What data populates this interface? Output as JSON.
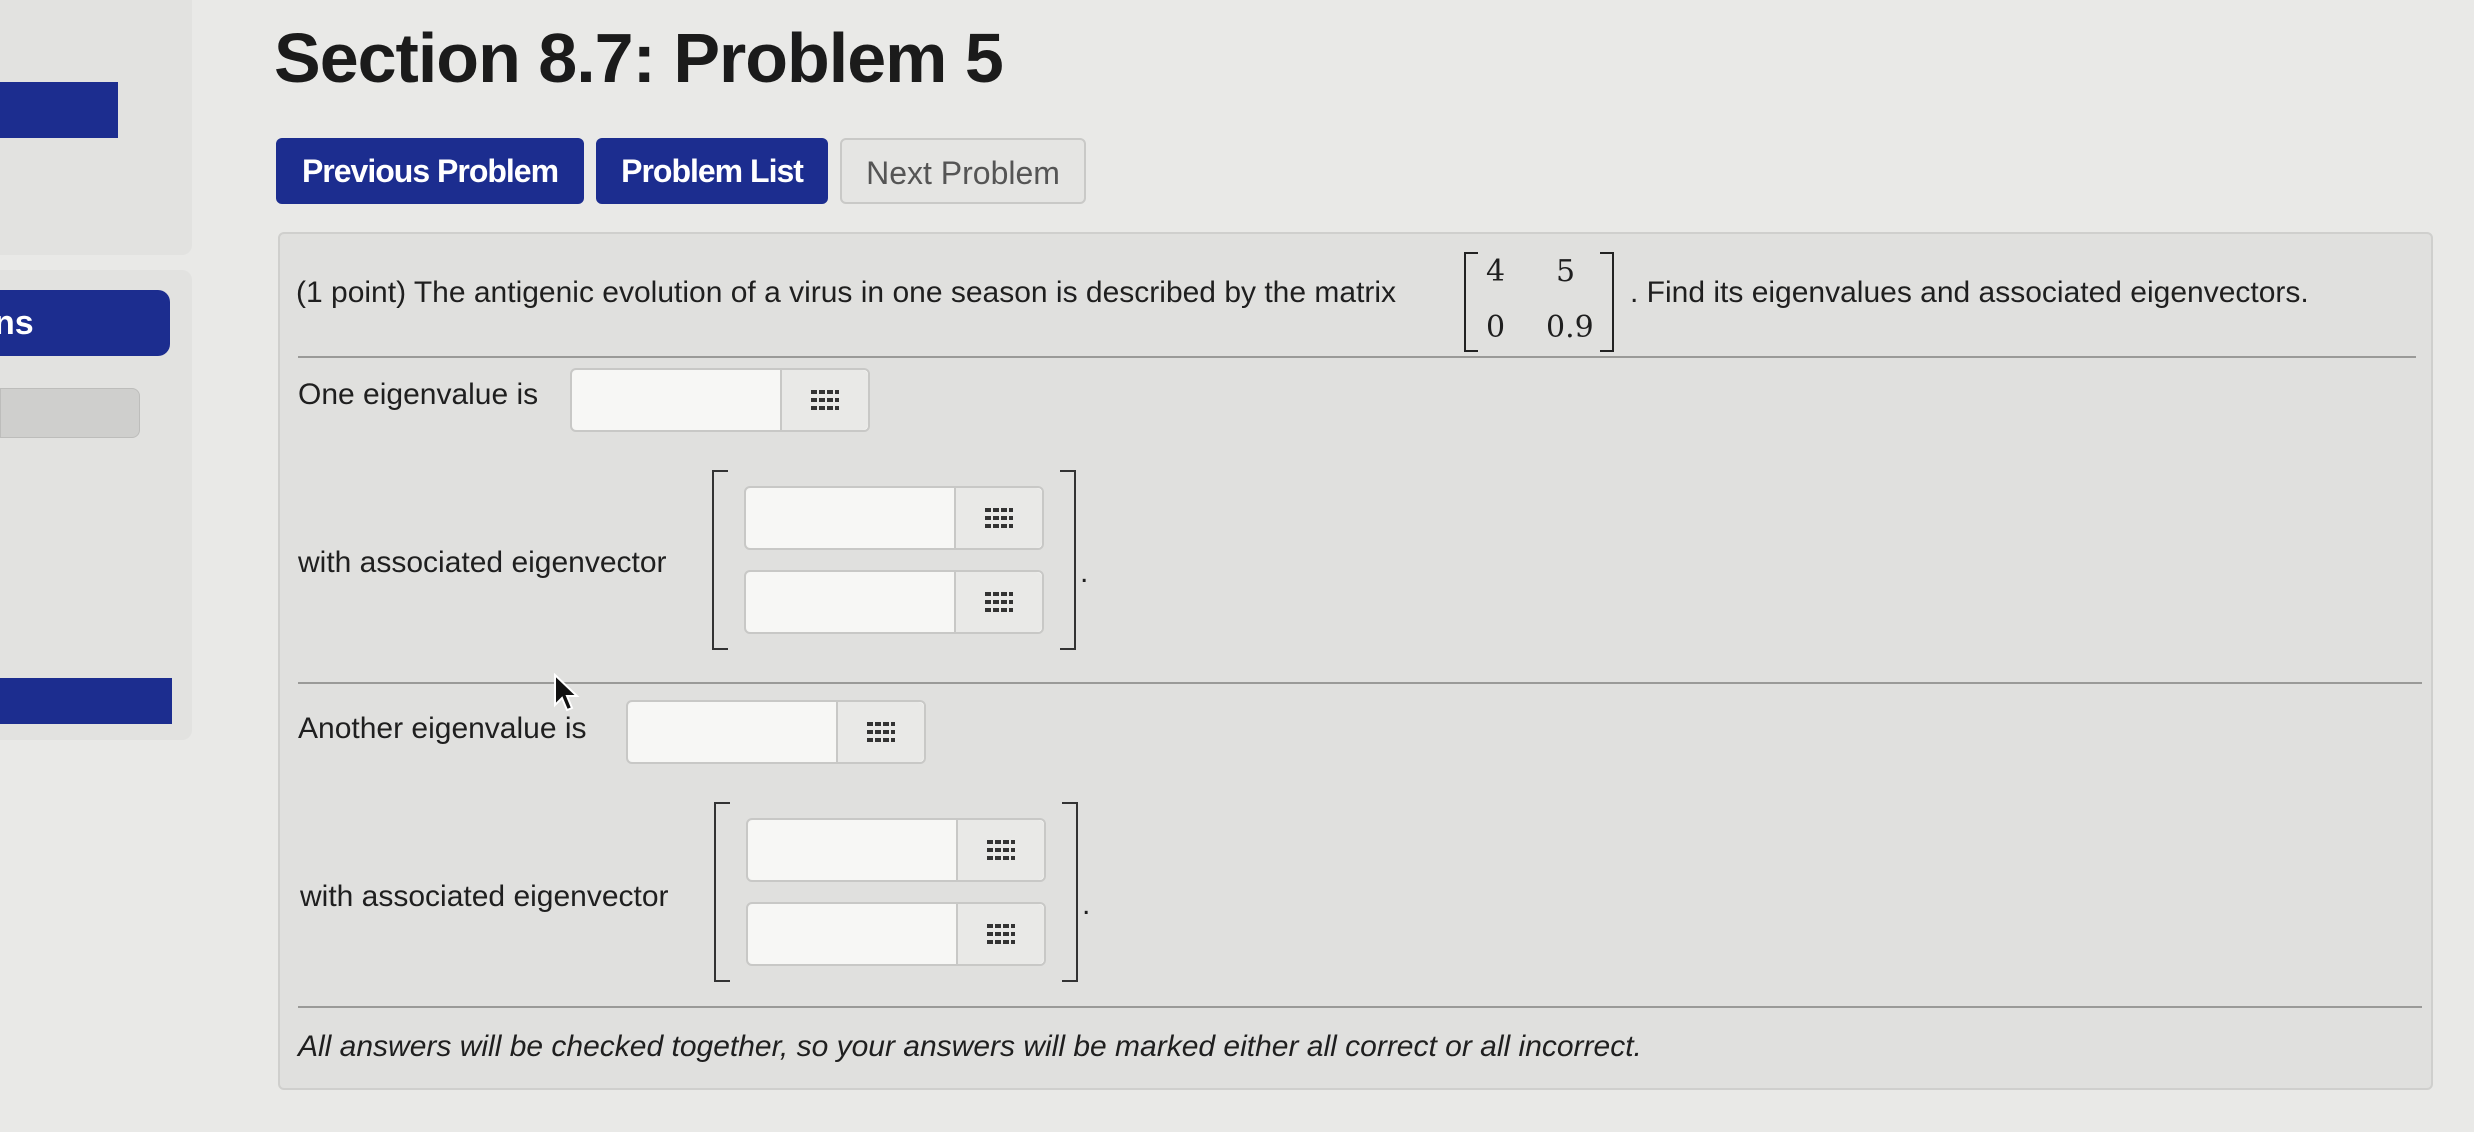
{
  "sidebar": {
    "tab_label": "ns"
  },
  "page": {
    "title": "Section 8.7: Problem 5"
  },
  "nav": {
    "previous_label": "Previous Problem",
    "list_label": "Problem List",
    "next_label": "Next Problem"
  },
  "problem": {
    "statement_before": "(1 point) The antigenic evolution of a virus in one season is described by the matrix",
    "matrix": {
      "a11": "4",
      "a12": "5",
      "a21": "0",
      "a22": "0.9"
    },
    "statement_after": ". Find its eigenvalues and associated eigenvectors.",
    "one_eigenvalue_label": "One eigenvalue is",
    "eigenvector_label_1": "with associated eigenvector",
    "another_eigenvalue_label": "Another eigenvalue is",
    "eigenvector_label_2": "with associated eigenvector",
    "period": ".",
    "note": "All answers will be checked together, so your answers will be marked either all correct or all incorrect."
  },
  "inputs": {
    "eigenvalue_1": "",
    "eigenvector_1_top": "",
    "eigenvector_1_bottom": "",
    "eigenvalue_2": "",
    "eigenvector_2_top": "",
    "eigenvector_2_bottom": ""
  },
  "icons": {
    "keypad": "keypad-icon",
    "cursor": "mouse-pointer-icon"
  },
  "colors": {
    "primary_button": "#1c2d8f",
    "background": "#e9e9e7",
    "panel": "#e0e0de"
  }
}
